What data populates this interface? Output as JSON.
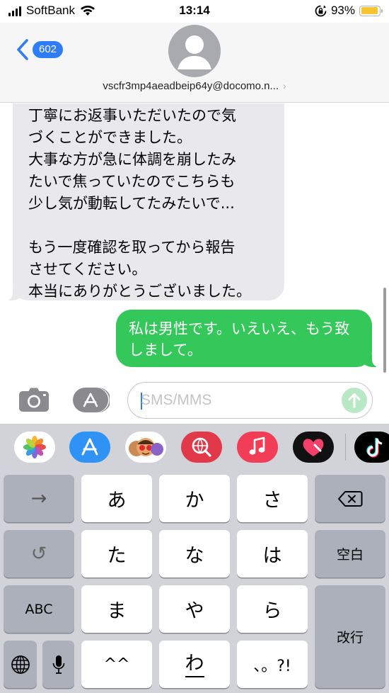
{
  "status_bar": {
    "carrier": "SoftBank",
    "time": "13:14",
    "battery_percent": "93%",
    "battery_level": 0.93,
    "battery_color": "#f7c531"
  },
  "header": {
    "back_count": "602",
    "contact": "vscfr3mp4aeadbeip64y@docomo.n...",
    "accent_color": "#2f7df6"
  },
  "conversation": {
    "incoming_text": "丁寧にお返事いただいたので気\nづくことができました。\n大事な方が急に体調を崩したみ\nたいで焦っていたのでこちらも\n少し気が動転してたみたいで...\n\nもう一度確認を取ってから報告\nさせてください。\n本当にありがとうございました。",
    "outgoing_text": "私は男性です。いえいえ、もう致しまして。",
    "outgoing_color": "#34c759"
  },
  "input": {
    "placeholder": "SMS/MMS",
    "icons": [
      "camera-icon",
      "app-store-icon",
      "send-arrow-icon"
    ]
  },
  "app_strip": {
    "apps": [
      "photos",
      "app-store",
      "memoji",
      "web-search",
      "music",
      "digital-touch",
      "tiktok"
    ]
  },
  "keyboard": {
    "next_label": "→",
    "undo_label": "↺",
    "abc_label": "ABC",
    "kana_a": "あ",
    "kana_ka": "か",
    "kana_sa": "さ",
    "kana_ta": "た",
    "kana_na": "な",
    "kana_ha": "は",
    "kana_ma": "ま",
    "kana_ya": "や",
    "kana_ra": "ら",
    "emoticon_label": "^^",
    "kana_wa": "わ",
    "punct_label": "、。?!",
    "space_label": "空白",
    "return_label": "改行"
  }
}
